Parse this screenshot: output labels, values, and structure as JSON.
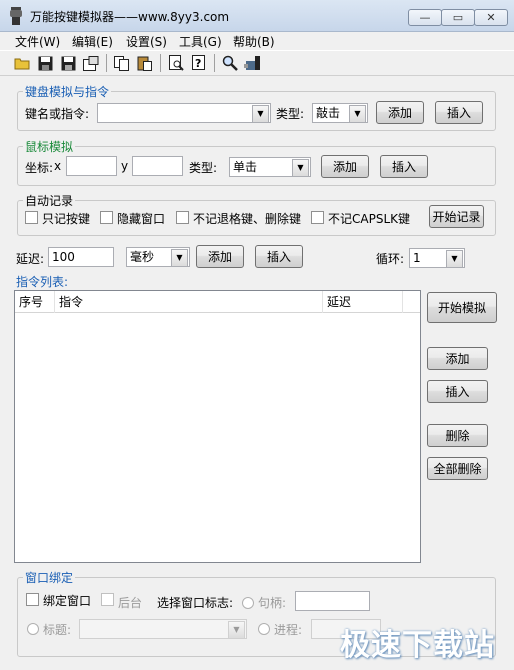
{
  "window": {
    "title": "万能按键模拟器——www.8yy3.com",
    "minimize": "—",
    "maximize": "▭",
    "close": "✕"
  },
  "menu": [
    "文件(W)",
    "编辑(E)",
    "设置(S)",
    "工具(G)",
    "帮助(B)"
  ],
  "toolbar": [
    "open-folder-icon",
    "save-icon",
    "save-as-icon",
    "properties-icon",
    "copy-icon",
    "paste-icon",
    "print-preview-icon",
    "help-icon",
    "find-icon",
    "tools-icon"
  ],
  "keyboard": {
    "group_title": "键盘模拟与指令",
    "keyname_label": "键名或指令:",
    "keyname_value": "",
    "type_label": "类型:",
    "type_value": "敲击",
    "add": "添加",
    "insert": "插入"
  },
  "mouse": {
    "group_title": "鼠标模拟",
    "coord_label": "坐标:",
    "x_label": "x",
    "x_value": "",
    "y_label": "y",
    "y_value": "",
    "type_label": "类型:",
    "type_value": "单击",
    "add": "添加",
    "insert": "插入"
  },
  "autorecord": {
    "group_title": "自动记录",
    "opt1": "只记按键",
    "opt2": "隐藏窗口",
    "opt3": "不记退格键、删除键",
    "opt4": "不记CAPSLK键",
    "start": "开始记录"
  },
  "delay": {
    "label": "延迟:",
    "value": "100",
    "unit": "毫秒",
    "add": "添加",
    "insert": "插入",
    "loop_label": "循环:",
    "loop_value": "1"
  },
  "list": {
    "title": "指令列表:",
    "columns": [
      "序号",
      "指令",
      "延迟"
    ],
    "rows": []
  },
  "side_buttons": {
    "start_sim": "开始模拟",
    "add": "添加",
    "insert": "插入",
    "delete": "删除",
    "delete_all": "全部删除"
  },
  "bind": {
    "group_title": "窗口绑定",
    "bind_window": "绑定窗口",
    "background": "后台",
    "select_flag": "选择窗口标志:",
    "handle": "句柄:",
    "handle_value": "",
    "title": "标题:",
    "title_value": "",
    "process": "进程:",
    "process_value": ""
  },
  "watermark": "极速下载站",
  "colors": {
    "group_label": "#1a5fb4",
    "titlebar": "#c7d6ea"
  }
}
